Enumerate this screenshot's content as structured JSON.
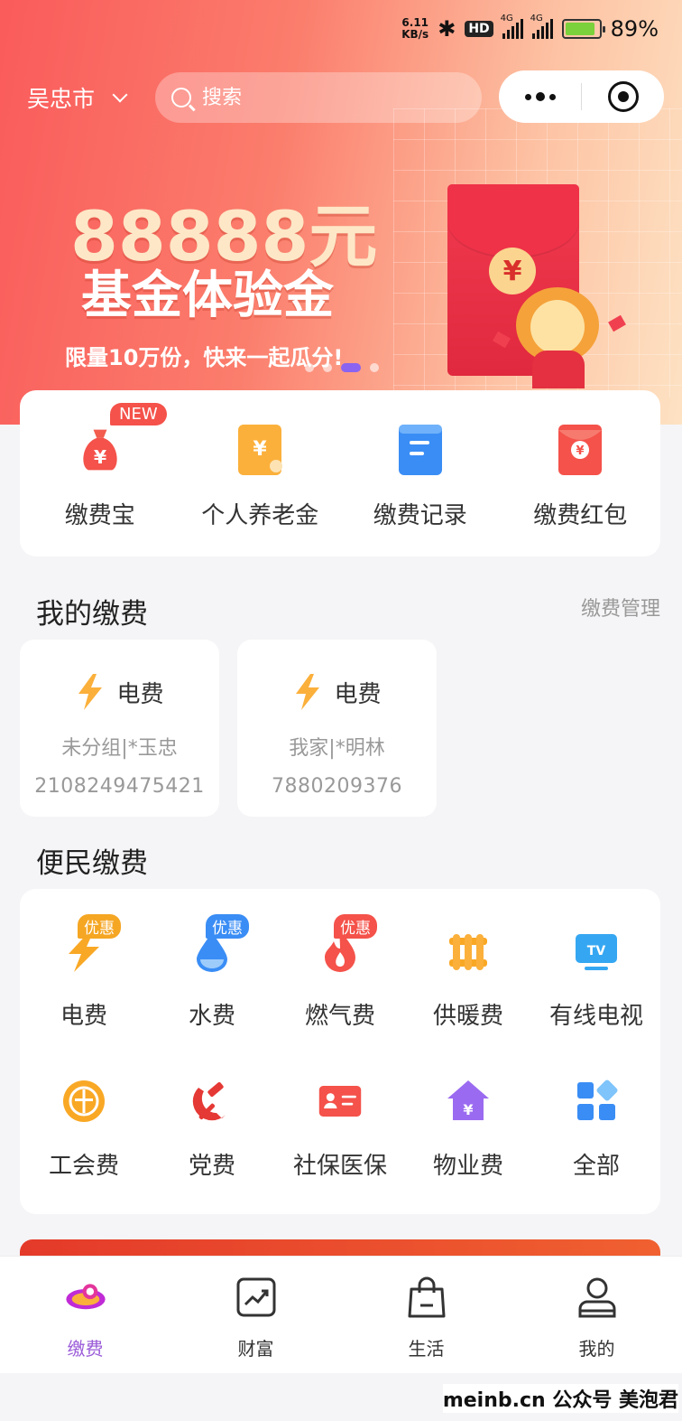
{
  "status_bar": {
    "speed_value": "6.11",
    "speed_unit": "KB/s",
    "hd": "HD",
    "net1": "4G",
    "net2": "4G",
    "battery": "89%",
    "battery_level": 0.89
  },
  "header": {
    "city": "吴忠市",
    "search_placeholder": "搜索"
  },
  "banner": {
    "amount": "88888元",
    "title": "基金体验金",
    "subtitle": "限量10万份，快来一起瓜分!",
    "coin": "¥",
    "slide_count": 4,
    "active_slide": 3
  },
  "quick": [
    {
      "label": "缴费宝",
      "icon": "money-bag-icon",
      "badge": "NEW",
      "color": "#f4524a"
    },
    {
      "label": "个人养老金",
      "icon": "pension-yuan-icon",
      "color": "#fbb03b"
    },
    {
      "label": "缴费记录",
      "icon": "record-list-icon",
      "color": "#3a8df5"
    },
    {
      "label": "缴费红包",
      "icon": "red-envelope-icon",
      "color": "#f4524a"
    }
  ],
  "my_bills": {
    "title": "我的缴费",
    "manage": "缴费管理",
    "items": [
      {
        "type": "电费",
        "group": "未分组|*玉忠",
        "account": "2108249475421"
      },
      {
        "type": "电费",
        "group": "我家|*明林",
        "account": "7880209376"
      }
    ]
  },
  "utilities": {
    "title": "便民缴费",
    "items": [
      {
        "label": "电费",
        "icon": "lightning-icon",
        "badge": "优惠",
        "badge_color": "#f5a623"
      },
      {
        "label": "水费",
        "icon": "water-drop-icon",
        "badge": "优惠",
        "badge_color": "#3a8df5"
      },
      {
        "label": "燃气费",
        "icon": "flame-icon",
        "badge": "优惠",
        "badge_color": "#f4524a"
      },
      {
        "label": "供暖费",
        "icon": "radiator-icon"
      },
      {
        "label": "有线电视",
        "icon": "tv-icon"
      },
      {
        "label": "工会费",
        "icon": "union-emblem-icon"
      },
      {
        "label": "党费",
        "icon": "party-emblem-icon"
      },
      {
        "label": "社保医保",
        "icon": "id-card-icon"
      },
      {
        "label": "物业费",
        "icon": "house-yuan-icon"
      },
      {
        "label": "全部",
        "icon": "all-grid-icon"
      }
    ]
  },
  "tabbar": [
    {
      "label": "缴费",
      "icon": "cloud-logo-icon",
      "active": true
    },
    {
      "label": "财富",
      "icon": "trend-chart-icon"
    },
    {
      "label": "生活",
      "icon": "shopping-bag-icon"
    },
    {
      "label": "我的",
      "icon": "person-icon"
    }
  ],
  "watermark": "meinb.cn 公众号 美泡君",
  "colors": {
    "accent": "#9a5bd8",
    "hero_red": "#fa5b5b"
  }
}
